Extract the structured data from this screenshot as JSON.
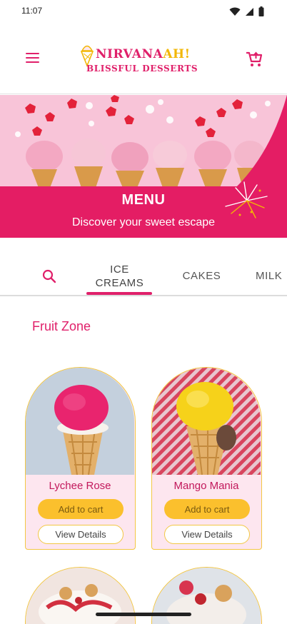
{
  "status_bar": {
    "time": "11:07"
  },
  "header": {
    "brand_main": "NIRVANA",
    "brand_accent": "AH!",
    "brand_tagline": "BLISSFUL DESSERTS"
  },
  "hero": {
    "title": "MENU",
    "subtitle": "Discover your sweet escape"
  },
  "tabs": [
    {
      "label": "ICE\nCREAMS",
      "active": true
    },
    {
      "label": "CAKES",
      "active": false
    },
    {
      "label": "MILK",
      "active": false
    }
  ],
  "section": {
    "title": "Fruit Zone"
  },
  "products": [
    {
      "name": "Lychee Rose",
      "add_label": "Add to cart",
      "view_label": "View Details"
    },
    {
      "name": "Mango Mania",
      "add_label": "Add to cart",
      "view_label": "View Details"
    }
  ],
  "colors": {
    "brand_pink": "#e0206a",
    "accent_yellow": "#fbc02d",
    "card_bg": "#fde6ef"
  },
  "icons": [
    "menu-icon",
    "cart-icon",
    "search-icon",
    "wifi-icon",
    "signal-icon",
    "battery-icon"
  ]
}
